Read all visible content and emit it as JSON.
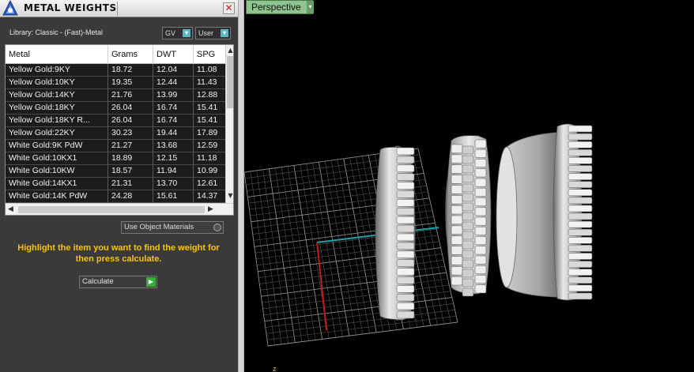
{
  "panel": {
    "title": "METAL WEIGHTS",
    "close_glyph": "✕",
    "library_label": "Library: Classic - (Fast)-Metal",
    "gv_select": "GV",
    "user_select": "User",
    "use_object_materials": "Use Object Materials",
    "hint": "Highlight the item you want to find the weight for then press calculate.",
    "calculate": "Calculate"
  },
  "table": {
    "columns": [
      "Metal",
      "Grams",
      "DWT",
      "SPG"
    ],
    "rows": [
      [
        "Yellow Gold:9KY",
        "18.72",
        "12.04",
        "11.08"
      ],
      [
        "Yellow Gold:10KY",
        "19.35",
        "12.44",
        "11.43"
      ],
      [
        "Yellow Gold:14KY",
        "21.76",
        "13.99",
        "12.88"
      ],
      [
        "Yellow Gold:18KY",
        "26.04",
        "16.74",
        "15.41"
      ],
      [
        "Yellow Gold:18KY R...",
        "26.04",
        "16.74",
        "15.41"
      ],
      [
        "Yellow Gold:22KY",
        "30.23",
        "19.44",
        "17.89"
      ],
      [
        "White Gold:9K PdW",
        "21.27",
        "13.68",
        "12.59"
      ],
      [
        "White Gold:10KX1",
        "18.89",
        "12.15",
        "11.18"
      ],
      [
        "White Gold:10KW",
        "18.57",
        "11.94",
        "10.99"
      ],
      [
        "White Gold:14KX1",
        "21.31",
        "13.70",
        "12.61"
      ],
      [
        "White Gold:14K PdW",
        "24.28",
        "15.61",
        "14.37"
      ]
    ]
  },
  "viewport": {
    "label": "Perspective",
    "axis_label": "z"
  },
  "icons": {
    "logo": "app-logo-icon",
    "close": "close-icon",
    "dropdown": "chevron-down-icon",
    "play": "play-icon"
  },
  "colors": {
    "hint_text": "#f6c500",
    "tab_green": "#8fc38f",
    "calc_green": "#34b034",
    "grid_x_axis": "#1fa0a8",
    "grid_y_axis": "#c81818"
  }
}
